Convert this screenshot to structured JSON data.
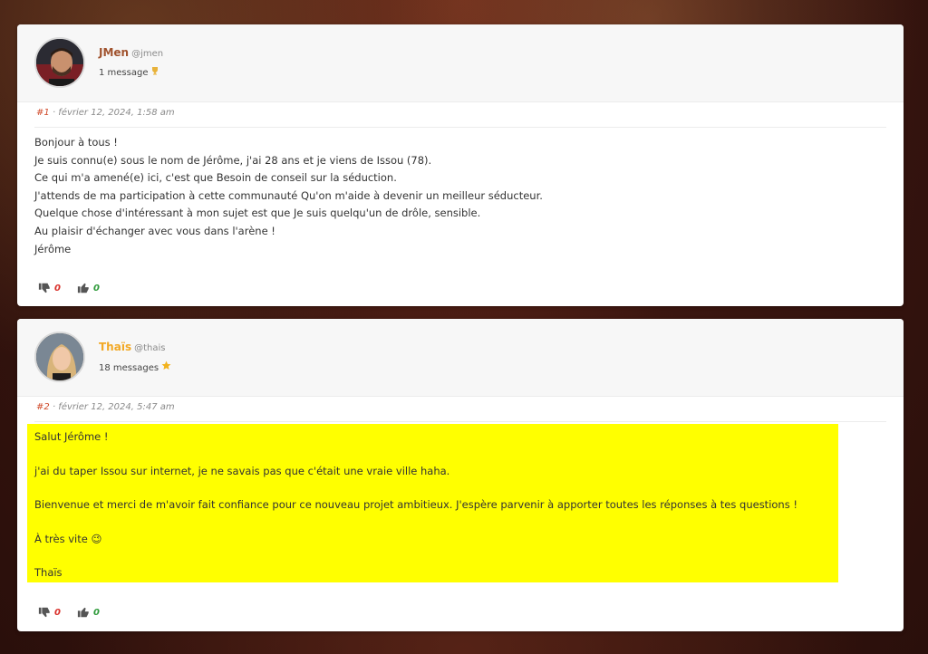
{
  "posts": [
    {
      "user": {
        "name": "JMen",
        "handle": "@jmen",
        "name_color": "#a0522d",
        "message_count": "1 message",
        "badge_icon": "trophy-icon"
      },
      "meta": {
        "number": "#1",
        "date": "· février 12, 2024, 1:58 am"
      },
      "body": [
        "Bonjour à tous !",
        "Je suis connu(e) sous le nom de Jérôme, j'ai 28 ans et je viens de Issou (78).",
        "Ce qui m'a amené(e) ici, c'est que Besoin de conseil sur la séduction.",
        "J'attends de ma participation à cette communauté Qu'on m'aide à devenir un meilleur séducteur.",
        "Quelque chose d'intéressant à mon sujet est que Je suis quelqu'un de drôle, sensible.",
        "Au plaisir d'échanger avec vous dans l'arène !",
        "Jérôme"
      ],
      "dislikes": "0",
      "likes": "0"
    },
    {
      "user": {
        "name": "Thaïs",
        "handle": "@thais",
        "name_color": "#f2a824",
        "message_count": "18 messages",
        "badge_icon": "star-icon"
      },
      "meta": {
        "number": "#2",
        "date": "· février 12, 2024, 5:47 am"
      },
      "body": [
        "Salut Jérôme !",
        "j'ai du taper Issou sur internet, je ne savais pas que c'était une vraie ville haha.",
        "Bienvenue et merci de m'avoir fait confiance pour ce nouveau projet ambitieux. J'espère parvenir à apporter toutes les réponses à tes questions !",
        "À très vite 😉",
        "Thaïs"
      ],
      "highlight_color": "#ffff00",
      "dislikes": "0",
      "likes": "0"
    }
  ]
}
